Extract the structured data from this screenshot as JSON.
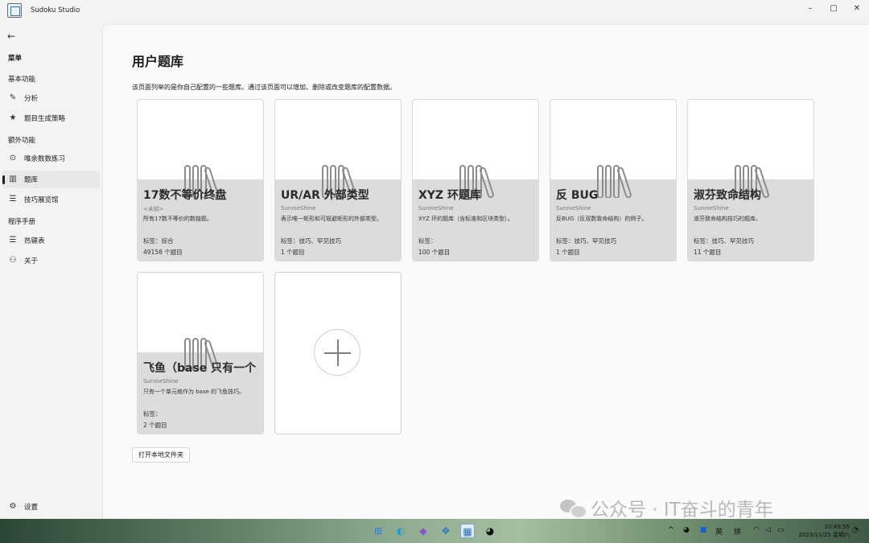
{
  "window": {
    "title": "Sudoku Studio",
    "controls": {
      "minimize": "–",
      "maximize": "▢",
      "close": "✕"
    }
  },
  "sidebar": {
    "back_icon": "back-arrow-icon",
    "sections": [
      {
        "label": "菜单"
      },
      {
        "label": "基本功能"
      },
      {
        "label": "额外功能"
      },
      {
        "label": "程序手册"
      }
    ],
    "items": [
      {
        "label": "分析",
        "icon": "pencil-icon"
      },
      {
        "label": "题目生成策略",
        "icon": "star-icon"
      },
      {
        "label": "唯余数数练习",
        "icon": "gamepad-icon"
      },
      {
        "label": "题库",
        "icon": "library-icon",
        "active": true
      },
      {
        "label": "技巧展览馆",
        "icon": "list-icon"
      },
      {
        "label": "热键表",
        "icon": "list-icon"
      },
      {
        "label": "关于",
        "icon": "people-icon"
      }
    ],
    "settings_label": "设置"
  },
  "page": {
    "title": "用户题库",
    "description": "该页面列举的是你自己配置的一些题库。通过该页面可以增加、删除或改变题库的配置数据。",
    "open_folder_label": "打开本地文件夹"
  },
  "cards": [
    {
      "title": "17数不等价终盘",
      "author": "<未知>",
      "desc": "所有17数不等价的数独题。",
      "tags": "标签：综合",
      "count": "49158 个题目"
    },
    {
      "title": "UR/AR 外部类型",
      "author": "SunnieShine",
      "desc": "表示唯一矩形和可规避矩形的外部类型。",
      "tags": "标签：技巧、罕见技巧",
      "count": "1 个题目"
    },
    {
      "title": "XYZ 环题库",
      "author": "SunnieShine",
      "desc": "XYZ 环的题库（含标准和区块类型）。",
      "tags": "标签：",
      "count": "100 个题目"
    },
    {
      "title": "反 BUG",
      "author": "SunnieShine",
      "desc": "反BUG（反双数致命结构）的例子。",
      "tags": "标签：技巧、罕见技巧",
      "count": "1 个题目"
    },
    {
      "title": "淑芬致命结构",
      "author": "SunnieShine",
      "desc": "淑芬致命结构技巧的题库。",
      "tags": "标签：技巧、罕见技巧",
      "count": "11 个题目"
    },
    {
      "title": "飞鱼（base 只有一个",
      "author": "SunnieShine",
      "desc": "只有一个单元格作为 base 的飞鱼技巧。",
      "tags": "标签：",
      "count": "2 个题目"
    }
  ],
  "add_card": {
    "icon": "plus-icon"
  },
  "watermark": {
    "text": "公众号 · IT奋斗的青年"
  },
  "taskbar": {
    "ime_lang": "英",
    "ime_mode": "拼",
    "time": "20:49:55",
    "date": "2023/11/25 星期六"
  },
  "colors": {
    "card_band": "#dcdcdc",
    "main_bg": "#fafafa",
    "sidebar_bg": "#f3f3f3"
  }
}
